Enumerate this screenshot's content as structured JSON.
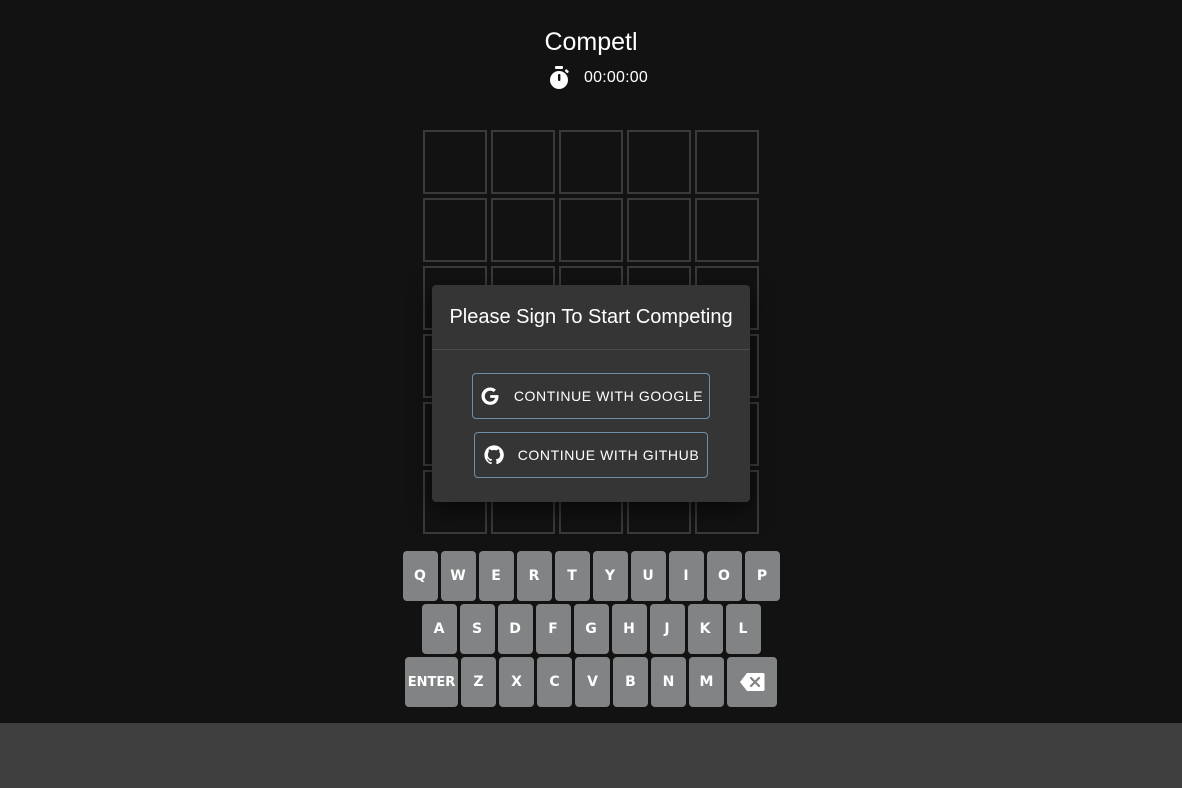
{
  "app": {
    "title": "Competl"
  },
  "timer": {
    "icon": "stopwatch-icon",
    "value": "00:00:00"
  },
  "board": {
    "rows": 6,
    "cols": 5
  },
  "dialog": {
    "title": "Please Sign To Start Competing",
    "google_label": "CONTINUE WITH GOOGLE",
    "github_label": "CONTINUE WITH GITHUB"
  },
  "keyboard": {
    "row1": [
      "Q",
      "W",
      "E",
      "R",
      "T",
      "Y",
      "U",
      "I",
      "O",
      "P"
    ],
    "row2": [
      "A",
      "S",
      "D",
      "F",
      "G",
      "H",
      "J",
      "K",
      "L"
    ],
    "row3": [
      "ENTER",
      "Z",
      "X",
      "C",
      "V",
      "B",
      "N",
      "M"
    ],
    "backspace_icon": "backspace-icon"
  },
  "colors": {
    "background": "#121212",
    "tile_border": "#3a3a3c",
    "key_bg": "#818384",
    "dialog_bg": "#353535",
    "button_border": "#6f8fa8",
    "bottom_bar": "#3f3f3f"
  }
}
